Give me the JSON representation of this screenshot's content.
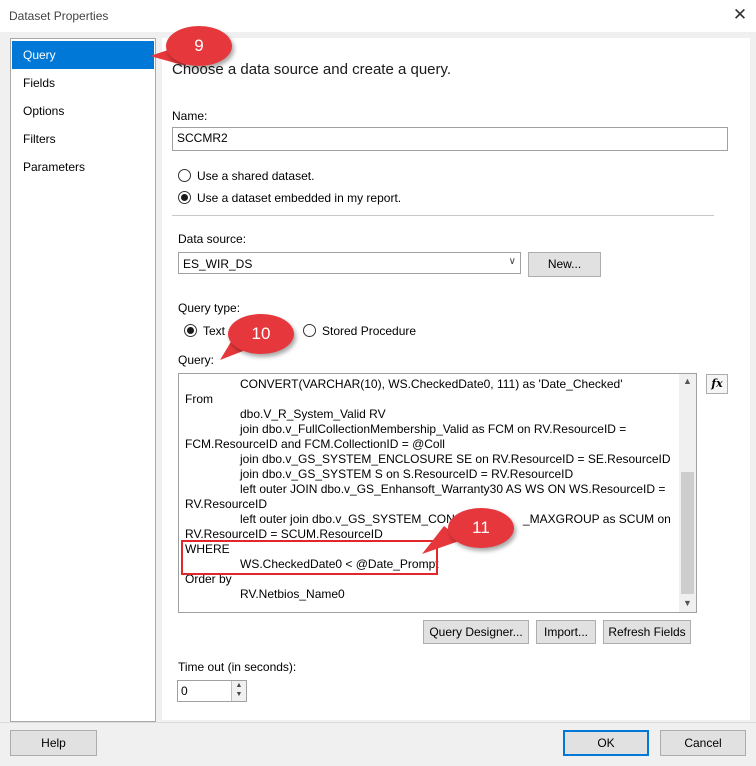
{
  "window": {
    "title": "Dataset Properties",
    "close_glyph": "✕"
  },
  "nav": {
    "items": [
      {
        "label": "Query",
        "selected": true
      },
      {
        "label": "Fields"
      },
      {
        "label": "Options"
      },
      {
        "label": "Filters"
      },
      {
        "label": "Parameters"
      }
    ]
  },
  "main": {
    "heading": "Choose a data source and create a query.",
    "name_label": "Name:",
    "name_value": "SCCMR2",
    "radio_shared": "Use a shared dataset.",
    "radio_embedded": "Use a dataset embedded in my report.",
    "datasource_label": "Data source:",
    "datasource_value": "ES_WIR_DS",
    "new_button": "New...",
    "query_type_label": "Query type:",
    "query_type_text": "Text",
    "query_type_stored": "Stored Procedure",
    "query_label": "Query:",
    "query_lines": [
      "CONVERT(VARCHAR(10), WS.CheckedDate0, 111) as 'Date_Checked'",
      "From",
      "dbo.V_R_System_Valid RV",
      "join dbo.v_FullCollectionMembership_Valid as FCM on RV.ResourceID =",
      "FCM.ResourceID and FCM.CollectionID = @Coll",
      "join dbo.v_GS_SYSTEM_ENCLOSURE SE on RV.ResourceID = SE.ResourceID",
      "join dbo.v_GS_SYSTEM S on S.ResourceID = RV.ResourceID",
      "left outer JOIN dbo.v_GS_Enhansoft_Warranty30 AS WS ON WS.ResourceID =",
      "RV.ResourceID",
      "left outer join dbo.v_GS_SYSTEM_CONSOL",
      "_MAXGROUP as SCUM on",
      "RV.ResourceID = SCUM.ResourceID",
      "WHERE",
      "WS.CheckedDate0 < @Date_Prompt",
      "Order by",
      "RV.Netbios_Name0"
    ],
    "fx_label": "fx",
    "query_designer_button": "Query Designer...",
    "import_button": "Import...",
    "refresh_button": "Refresh Fields",
    "timeout_label": "Time out (in seconds):",
    "timeout_value": "0"
  },
  "footer": {
    "help": "Help",
    "ok": "OK",
    "cancel": "Cancel"
  },
  "callouts": [
    "9",
    "10",
    "11"
  ],
  "colors": {
    "accent": "#0078d7",
    "callout": "#e6383c",
    "highlight_border": "#e3252c"
  }
}
